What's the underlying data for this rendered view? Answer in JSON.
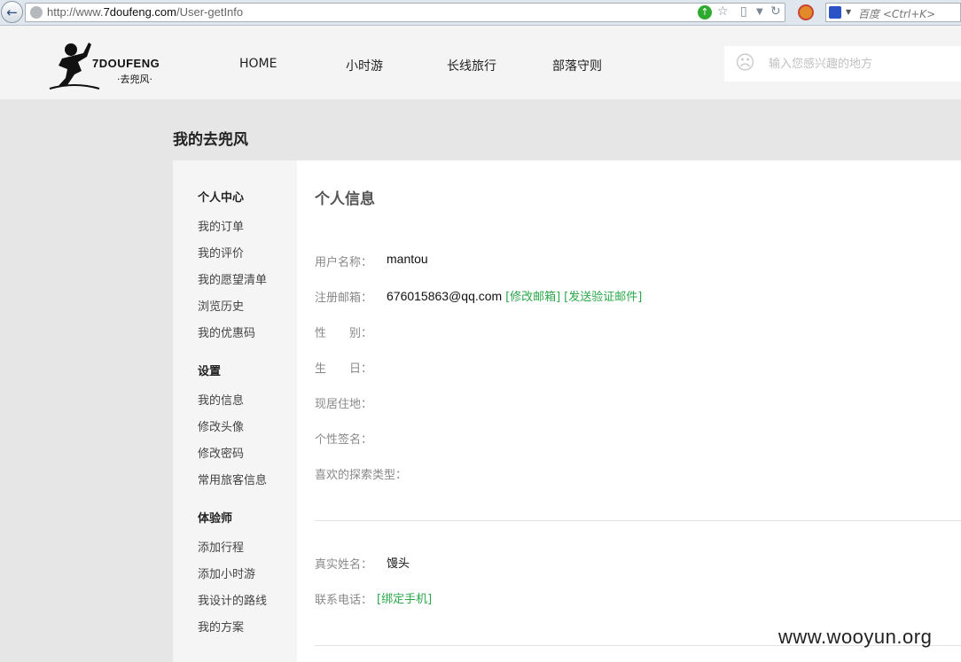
{
  "browser": {
    "url_prefix": "http://www.",
    "url_domain": "7doufeng.com",
    "url_path": "/User-getInfo",
    "search_placeholder": "百度 <Ctrl+K>"
  },
  "header": {
    "logo_text": "7DOUFENG",
    "logo_sub": "·去兜风·",
    "nav": [
      "HOME",
      "小时游",
      "长线旅行",
      "部落守则"
    ],
    "search_placeholder": "输入您感兴趣的地方"
  },
  "page_title": "我的去兜风",
  "sidebar": {
    "groups": [
      {
        "title": "个人中心",
        "items": [
          "我的订单",
          "我的评价",
          "我的愿望清单",
          "浏览历史",
          "我的优惠码"
        ]
      },
      {
        "title": "设置",
        "items": [
          "我的信息",
          "修改头像",
          "修改密码",
          "常用旅客信息"
        ]
      },
      {
        "title": "体验师",
        "items": [
          "添加行程",
          "添加小时游",
          "我设计的路线",
          "我的方案"
        ]
      }
    ]
  },
  "content": {
    "title": "个人信息",
    "fields": [
      {
        "label": "用户名称：",
        "value": "mantou"
      },
      {
        "label": "注册邮箱：",
        "value": "676015863@qq.com",
        "links": [
          "[修改邮箱]",
          "[发送验证邮件]"
        ]
      },
      {
        "label": "性　　别：",
        "value": ""
      },
      {
        "label": "生　　日：",
        "value": ""
      },
      {
        "label": "现居住地：",
        "value": ""
      },
      {
        "label": "个性签名：",
        "value": ""
      },
      {
        "label": "喜欢的探索类型：",
        "value": ""
      }
    ],
    "fields2": [
      {
        "label": "真实姓名：",
        "value": "馒头"
      },
      {
        "label": "联系电话：",
        "links": [
          "[绑定手机]"
        ]
      }
    ]
  },
  "watermark": "www.wooyun.org",
  "colors": {
    "link": "#2aa84a",
    "sidebar_bg": "#f5f5f5",
    "page_bg": "#e6e6e6"
  }
}
